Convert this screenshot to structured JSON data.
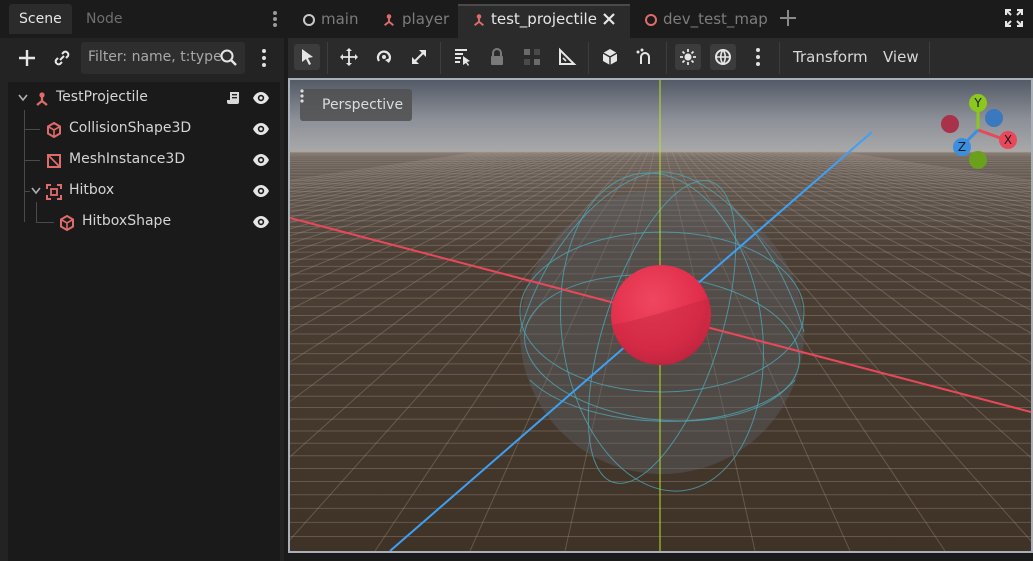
{
  "dock": {
    "tabs": [
      {
        "label": "Scene",
        "active": true
      },
      {
        "label": "Node",
        "active": false
      }
    ],
    "filter_placeholder": "Filter: name, t:type",
    "tree": [
      {
        "label": "TestProjectile",
        "icon": "node3d-root-icon",
        "depth": 0,
        "expanded": true,
        "has_script": true
      },
      {
        "label": "CollisionShape3D",
        "icon": "collision-shape-icon",
        "depth": 1
      },
      {
        "label": "MeshInstance3D",
        "icon": "mesh-instance-icon",
        "depth": 1
      },
      {
        "label": "Hitbox",
        "icon": "area3d-icon",
        "depth": 1,
        "expanded": true
      },
      {
        "label": "HitboxShape",
        "icon": "collision-shape-icon",
        "depth": 2
      }
    ]
  },
  "scene_tabs": [
    {
      "label": "main",
      "icon": "circle-node-icon",
      "active": false,
      "color": "#c8c8c8"
    },
    {
      "label": "player",
      "icon": "node3d-icon",
      "active": false,
      "color": "#e06b6b"
    },
    {
      "label": "test_projectile",
      "icon": "node3d-icon",
      "active": true,
      "color": "#e06b6b"
    },
    {
      "label": "dev_test_map",
      "icon": "circle-node-icon",
      "active": false,
      "color": "#e06b6b"
    }
  ],
  "viewport_toolbar": {
    "menus": [
      "Transform",
      "View"
    ]
  },
  "viewport": {
    "perspective_label": "Perspective",
    "gizmo": {
      "x": "X",
      "y": "Y",
      "z": "Z"
    }
  },
  "colors": {
    "accent_red": "#e8485a",
    "axis_red": "#e8485a",
    "axis_blue": "#3ea0f5",
    "axis_green": "#b8e02a",
    "icon_red": "#e06b6b"
  }
}
